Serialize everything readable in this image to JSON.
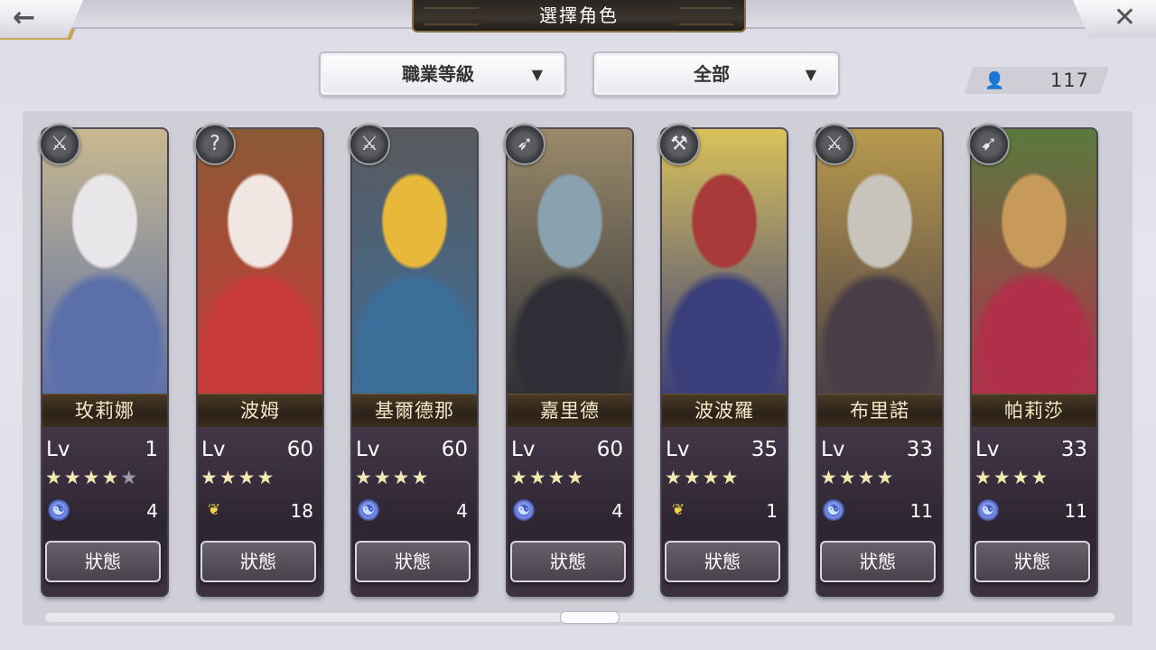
{
  "header": {
    "title": "選擇角色",
    "back_icon": "←",
    "close_icon": "✕"
  },
  "filters": {
    "job": {
      "label": "職業等級",
      "arrow": "▼"
    },
    "scope": {
      "label": "全部",
      "arrow": "▼"
    }
  },
  "character_count": {
    "icon": "👤",
    "value": "117"
  },
  "cards": [
    {
      "name": "玫莉娜",
      "lv_label": "Lv",
      "level": "1",
      "stars_on": "★★★★",
      "stars_off": "★",
      "resource_icon": "ring",
      "resource_glyph": "☯",
      "resource": "4",
      "status": "狀態",
      "weapon_glyph": "⚔",
      "weapon_name": "gauntlet-icon",
      "colors": [
        "#e9e6ea",
        "#5b6fa8",
        "#c9b98f"
      ]
    },
    {
      "name": "波姆",
      "lv_label": "Lv",
      "level": "60",
      "stars_on": "★★★★",
      "stars_off": "",
      "resource_icon": "wing",
      "resource_glyph": "❦",
      "resource": "18",
      "status": "狀態",
      "weapon_glyph": "?",
      "weapon_name": "fist-icon",
      "colors": [
        "#f1e6e2",
        "#c83a3a",
        "#8a5a34"
      ]
    },
    {
      "name": "基爾德那",
      "lv_label": "Lv",
      "level": "60",
      "stars_on": "★★★★",
      "stars_off": "",
      "resource_icon": "ring",
      "resource_glyph": "☯",
      "resource": "4",
      "status": "狀態",
      "weapon_glyph": "⚔",
      "weapon_name": "sword-icon",
      "colors": [
        "#e7b83a",
        "#3c6e9a",
        "#5a5a5e"
      ]
    },
    {
      "name": "嘉里德",
      "lv_label": "Lv",
      "level": "60",
      "stars_on": "★★★★",
      "stars_off": "",
      "resource_icon": "ring",
      "resource_glyph": "☯",
      "resource": "4",
      "status": "狀態",
      "weapon_glyph": "➶",
      "weapon_name": "spear-icon",
      "colors": [
        "#8aa2b0",
        "#2e2f36",
        "#9a8a6a"
      ]
    },
    {
      "name": "波波羅",
      "lv_label": "Lv",
      "level": "35",
      "stars_on": "★★★★",
      "stars_off": "",
      "resource_icon": "wing",
      "resource_glyph": "❦",
      "resource": "1",
      "status": "狀態",
      "weapon_glyph": "⚒",
      "weapon_name": "gauntlet-icon",
      "colors": [
        "#a93a3a",
        "#3a3e7a",
        "#d9c25a"
      ]
    },
    {
      "name": "布里諾",
      "lv_label": "Lv",
      "level": "33",
      "stars_on": "★★★★",
      "stars_off": "",
      "resource_icon": "ring",
      "resource_glyph": "☯",
      "resource": "11",
      "status": "狀態",
      "weapon_glyph": "⚔",
      "weapon_name": "sword-icon",
      "colors": [
        "#c8c4bc",
        "#4a3e46",
        "#b89a4e"
      ]
    },
    {
      "name": "帕莉莎",
      "lv_label": "Lv",
      "level": "33",
      "stars_on": "★★★★",
      "stars_off": "",
      "resource_icon": "ring",
      "resource_glyph": "☯",
      "resource": "11",
      "status": "狀態",
      "weapon_glyph": "➹",
      "weapon_name": "bow-icon",
      "colors": [
        "#c89a5a",
        "#b0304a",
        "#5a7a3e"
      ]
    }
  ]
}
